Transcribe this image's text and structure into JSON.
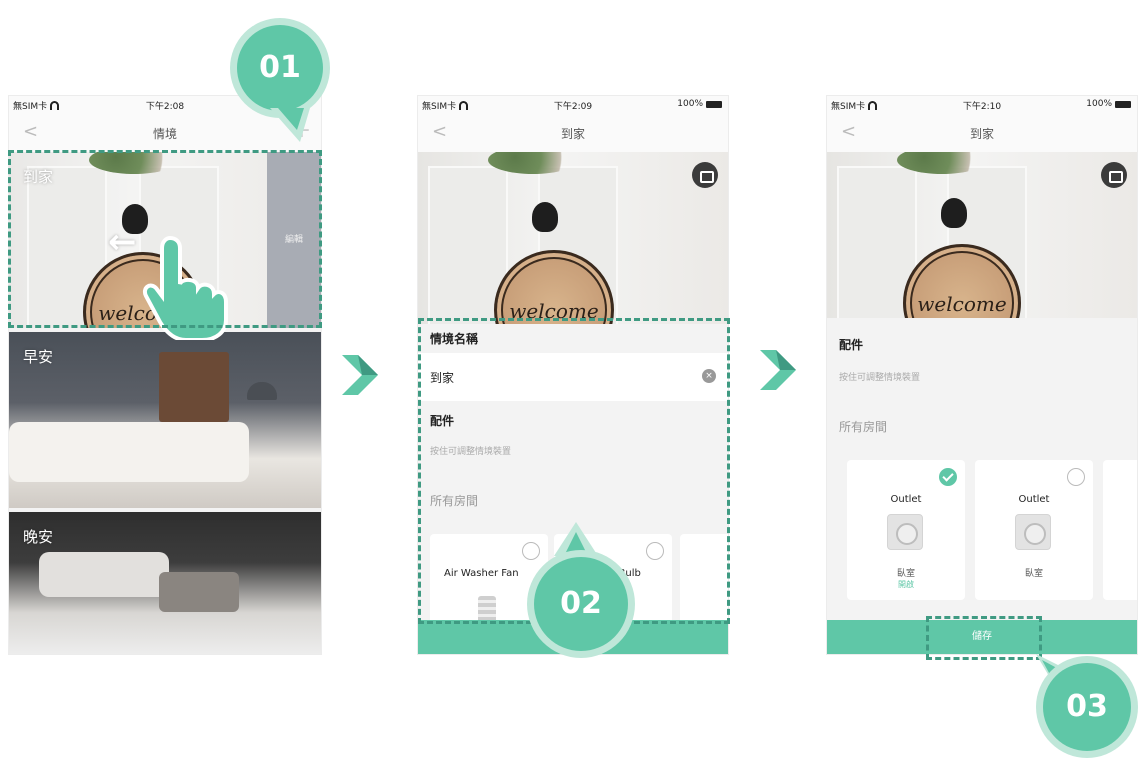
{
  "steps": [
    "01",
    "02",
    "03"
  ],
  "phone1": {
    "status": {
      "carrier": "無SIM卡",
      "time": "下午2:08"
    },
    "nav": {
      "title": "情境",
      "back": "<",
      "add": "+"
    },
    "scenes": [
      {
        "label": "到家",
        "edit_label": "編輯"
      },
      {
        "label": "早安"
      },
      {
        "label": "晚安"
      }
    ],
    "swipe_arrow": "←"
  },
  "phone2": {
    "status": {
      "carrier": "無SIM卡",
      "time": "下午2:09",
      "battery": "100%"
    },
    "nav": {
      "title": "到家",
      "back": "<"
    },
    "welcome_text": "welcome",
    "name_section": "情境名稱",
    "name_value": "到家",
    "accessories_section": "配件",
    "hint": "按住可調整情境裝置",
    "rooms": "所有房間",
    "cards": [
      {
        "name": "Air Washer Fan"
      },
      {
        "name": "Smart Bulb"
      }
    ]
  },
  "phone3": {
    "status": {
      "carrier": "無SIM卡",
      "time": "下午2:10",
      "battery": "100%"
    },
    "nav": {
      "title": "到家",
      "back": "<"
    },
    "welcome_text": "welcome",
    "accessories_section": "配件",
    "hint": "按住可調整情境裝置",
    "rooms": "所有房間",
    "cards": [
      {
        "name": "Outlet",
        "room": "臥室",
        "status": "開啟",
        "checked": true
      },
      {
        "name": "Outlet",
        "room": "臥室",
        "status": "",
        "checked": false
      }
    ],
    "save_label": "儲存"
  },
  "colors": {
    "accent": "#5fc7a7",
    "accent_light": "#bfe7d9",
    "dash": "#3f9a82"
  }
}
